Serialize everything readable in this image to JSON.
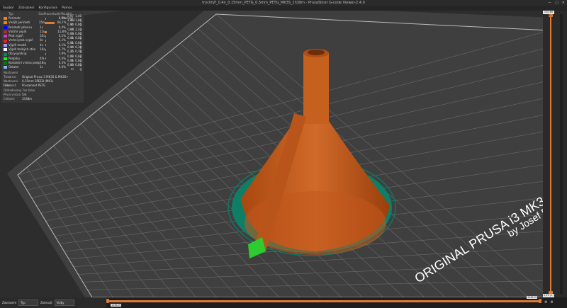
{
  "window": {
    "title": "trychtýř_0.4n_0.15mm_PETG_0.5mm_PETG_MK3S_1h38m - PrusaSlicer G-code Viewer-2.4.0",
    "controls": [
      "—",
      "▢",
      "✕"
    ]
  },
  "menu": [
    "Soubor",
    "Zobrazení",
    "Konfigurace",
    "Pomoc"
  ],
  "legend": {
    "headers": {
      "type": "Typ",
      "time": "Čas",
      "pct": "Procentuální",
      "usage": "Použitý filament"
    },
    "rows": [
      {
        "name": "Perimetr",
        "time": "",
        "pct": "8,6%",
        "m": "0,47 m",
        "g": "1,40 g",
        "color": "#ff7f00",
        "bar": 0.1
      },
      {
        "name": "Vnější perimetr",
        "time": "35m",
        "pct": "66,7%",
        "m": "3,85 m",
        "g": "11,86 g",
        "color": "#ff7f00",
        "bar": 0.8
      },
      {
        "name": "Perimetr převisu",
        "time": "1s",
        "pct": "0,0%",
        "m": "0,00 m",
        "g": "0,00 g",
        "color": "#0000ff",
        "bar": 0.0
      },
      {
        "name": "Vnitřní výplň",
        "time": "11s",
        "pct": "11,8%",
        "m": "0,68 m",
        "g": "2,23 g",
        "color": "#b03029",
        "bar": 0.14
      },
      {
        "name": "Plná výplň",
        "time": "35s",
        "pct": "0,1%",
        "m": "0,00 m",
        "g": "0,00 g",
        "color": "#d732d7",
        "bar": 0.01
      },
      {
        "name": "Vrchní plná výplň",
        "time": "8s",
        "pct": "0,1%",
        "m": "0,01 m",
        "g": "0,02 g",
        "color": "#ff1a1a",
        "bar": 0.01
      },
      {
        "name": "Výplň mostů",
        "time": "4s",
        "pct": "0,1%",
        "m": "0,01 m",
        "g": "0,02 g",
        "color": "#9999ff",
        "bar": 0.01
      },
      {
        "name": "Výplň tenkých stěn",
        "time": "10s",
        "pct": "6,7%",
        "m": "0,04 m",
        "g": "0,18 g",
        "color": "#ffffff",
        "bar": 0.05
      },
      {
        "name": "Obrysy/okraj",
        "time": "",
        "pct": "7,9%",
        "m": "0,25 m",
        "g": "0,79 g",
        "color": "#00876e",
        "bar": 0.09
      },
      {
        "name": "Podpěry",
        "time": "4%",
        "pct": "0,0%",
        "m": "0,02 m",
        "g": "0,07 g",
        "color": "#00ff00",
        "bar": 0.01
      },
      {
        "name": "Kontaktní vrstva podpěr",
        "time": "18s",
        "pct": "0,3%",
        "m": "0,01 m",
        "g": "0,04 g",
        "color": "#008000",
        "bar": 0.01
      },
      {
        "name": "Ostatní",
        "time": "1s",
        "pct": "0,0%",
        "m": "0,00 m",
        "g": "0,00 g",
        "color": "#7fb9ea",
        "bar": 0.0
      }
    ],
    "section_settings": "Nastavení",
    "info": [
      {
        "k": "Tiskárna:",
        "v": "Original Prusa i3 MK3S & MK3S+"
      },
      {
        "k": "Nastavení tisku:",
        "v": "0,15mm SPEED (MK3)"
      },
      {
        "k": "Filament:",
        "v": "Prusament PETG"
      }
    ],
    "section_time": "Odhadovaný čas tisku",
    "time_info": [
      {
        "k": "První vrstva:",
        "v": "5m"
      },
      {
        "k": "Celkem:",
        "v": "1h38m"
      }
    ]
  },
  "sliders": {
    "v_top": "110,60 (80)",
    "v_bottom": "0,20 (1)",
    "h_value": "128125",
    "h_min": "126125"
  },
  "bottom": {
    "view_label": "Zobrazení",
    "view_value": "Typ",
    "show_label": "Zobrazit",
    "show_value": "Volby"
  },
  "bed": {
    "brand_text": "ORIGINAL PRUSA i3 MK3",
    "brand_sub": "by Josef P"
  },
  "colors": {
    "model": "#c85a1b",
    "skirt": "#0d7a63",
    "support": "#2ecc2e"
  }
}
